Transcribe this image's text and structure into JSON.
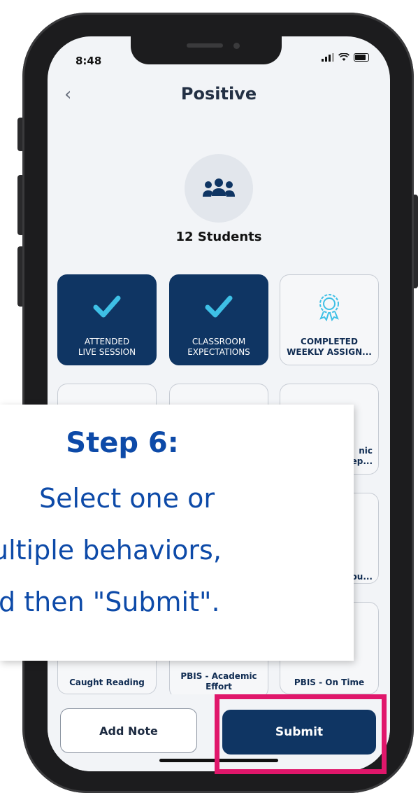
{
  "status_bar": {
    "time": "8:48"
  },
  "header": {
    "back_icon": "chevron-left-icon",
    "title": "Positive"
  },
  "group": {
    "icon": "users-icon",
    "count_label": "12 Students"
  },
  "behaviors": [
    {
      "label_line1": "ATTENDED",
      "label_line2": "LIVE SESSION",
      "selected": true,
      "icon": "checkmark-icon"
    },
    {
      "label_line1": "CLASSROOM",
      "label_line2": "EXPECTATIONS",
      "selected": true,
      "icon": "checkmark-icon"
    },
    {
      "label_line1": "COMPLETED",
      "label_line2": "WEEKLY ASSIGN...",
      "selected": false,
      "icon": "badge-icon"
    }
  ],
  "partial_cards": [
    {
      "label_line1": "nic",
      "label_line2": "ep..."
    },
    {
      "label_line1": "ou...",
      "label_line2": ""
    }
  ],
  "bottom_row": [
    {
      "label": "Caught Reading"
    },
    {
      "label": "PBIS - Academic Effort"
    },
    {
      "label": "PBIS - On Time"
    }
  ],
  "footer": {
    "add_note_label": "Add Note",
    "submit_label": "Submit"
  },
  "callout": {
    "heading": "Step 6:",
    "line1": "Select one or",
    "line2": "ultiple behaviors,",
    "line3": "d then \"Submit\"."
  },
  "colors": {
    "accent": "#0f3563",
    "highlight": "#e0176b",
    "callout_text": "#0d4aa8",
    "check": "#3ec0e6"
  }
}
